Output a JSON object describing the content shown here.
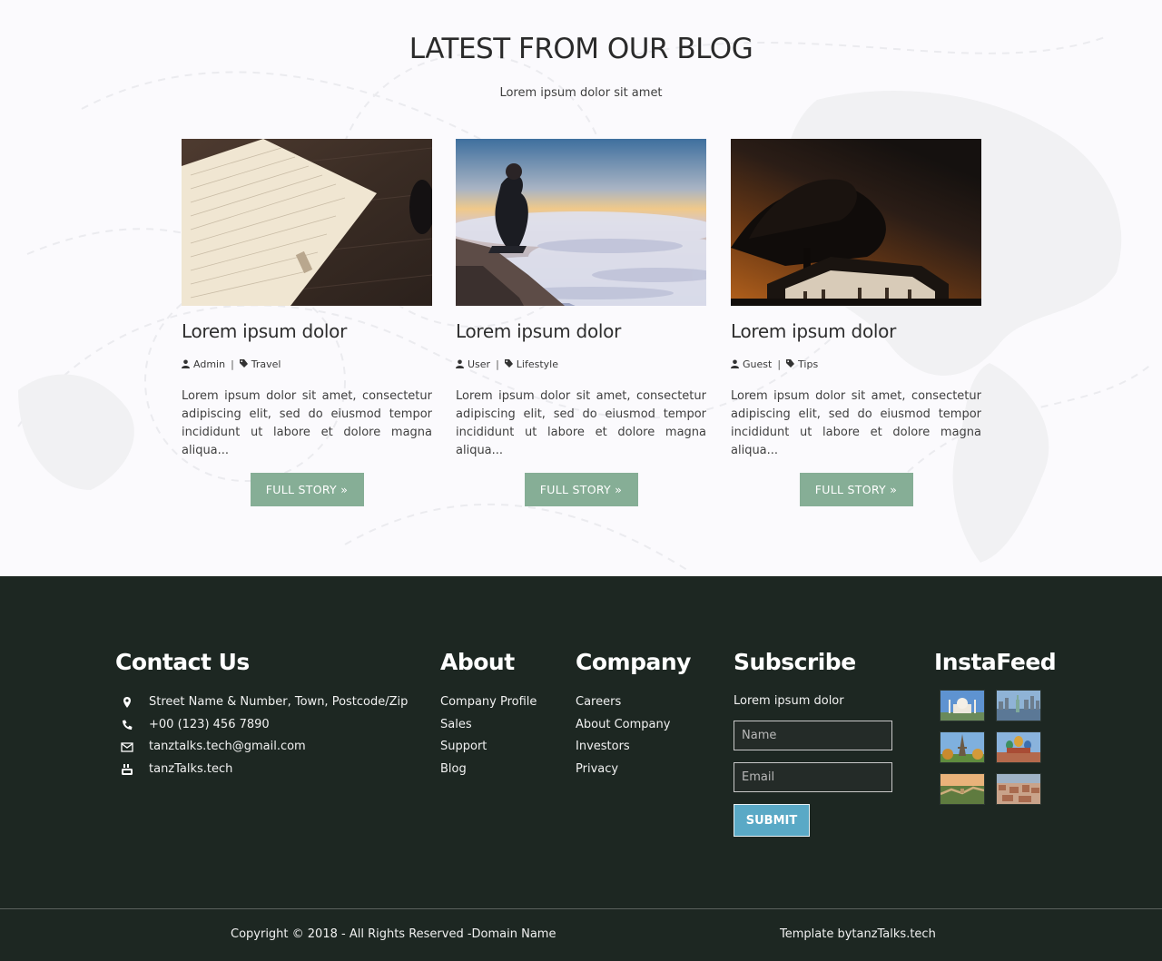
{
  "blog": {
    "title": "LATEST FROM OUR BLOG",
    "subtitle": "Lorem ipsum dolor sit amet",
    "posts": [
      {
        "image": "notebook-photo",
        "title": "Lorem ipsum dolor",
        "author": "Admin",
        "category": "Travel",
        "excerpt": "Lorem ipsum dolor sit amet, consectetur adipiscing elit, sed do eiusmod tempor incididunt ut labore et dolore magna aliqua...",
        "button": "FULL STORY »"
      },
      {
        "image": "mountain-clouds-photo",
        "title": "Lorem ipsum dolor",
        "author": "User",
        "category": "Lifestyle",
        "excerpt": "Lorem ipsum dolor sit amet, consectetur adipiscing elit, sed do eiusmod tempor incididunt ut labore et dolore magna aliqua...",
        "button": "FULL STORY »"
      },
      {
        "image": "night-tree-church-photo",
        "title": "Lorem ipsum dolor",
        "author": "Guest",
        "category": "Tips",
        "excerpt": "Lorem ipsum dolor sit amet, consectetur adipiscing elit, sed do eiusmod tempor incididunt ut labore et dolore magna aliqua...",
        "button": "FULL STORY »"
      }
    ]
  },
  "footer": {
    "contact": {
      "heading": "Contact Us",
      "items": [
        {
          "icon": "location-pin-icon",
          "text": "Street Name & Number, Town, Postcode/Zip"
        },
        {
          "icon": "phone-icon",
          "text": "+00 (123) 456 7890"
        },
        {
          "icon": "envelope-icon",
          "text": "tanztalks.tech@gmail.com"
        },
        {
          "icon": "youtube-icon",
          "text": "tanzTalks.tech"
        }
      ]
    },
    "about": {
      "heading": "About",
      "links": [
        "Company Profile",
        "Sales",
        "Support",
        "Blog"
      ]
    },
    "company": {
      "heading": "Company",
      "links": [
        "Careers",
        "About Company",
        "Investors",
        "Privacy"
      ]
    },
    "subscribe": {
      "heading": "Subscribe",
      "text": "Lorem ipsum dolor",
      "name_placeholder": "Name",
      "email_placeholder": "Email",
      "button": "SUBMIT"
    },
    "instafeed": {
      "heading": "InstaFeed",
      "images": [
        "taj-mahal-thumb",
        "statue-of-liberty-thumb",
        "eiffel-tower-thumb",
        "st-basil-cathedral-thumb",
        "great-wall-thumb",
        "city-aerial-thumb"
      ]
    },
    "copyright": "Copyright © 2018 - All Rights Reserved -Domain Name",
    "credit": "Template bytanzTalks.tech"
  },
  "colors": {
    "accent_button": "#86ae96",
    "footer_bg": "#1d2722",
    "submit_button": "#5aa9c6",
    "page_bg": "#fbfafd"
  }
}
